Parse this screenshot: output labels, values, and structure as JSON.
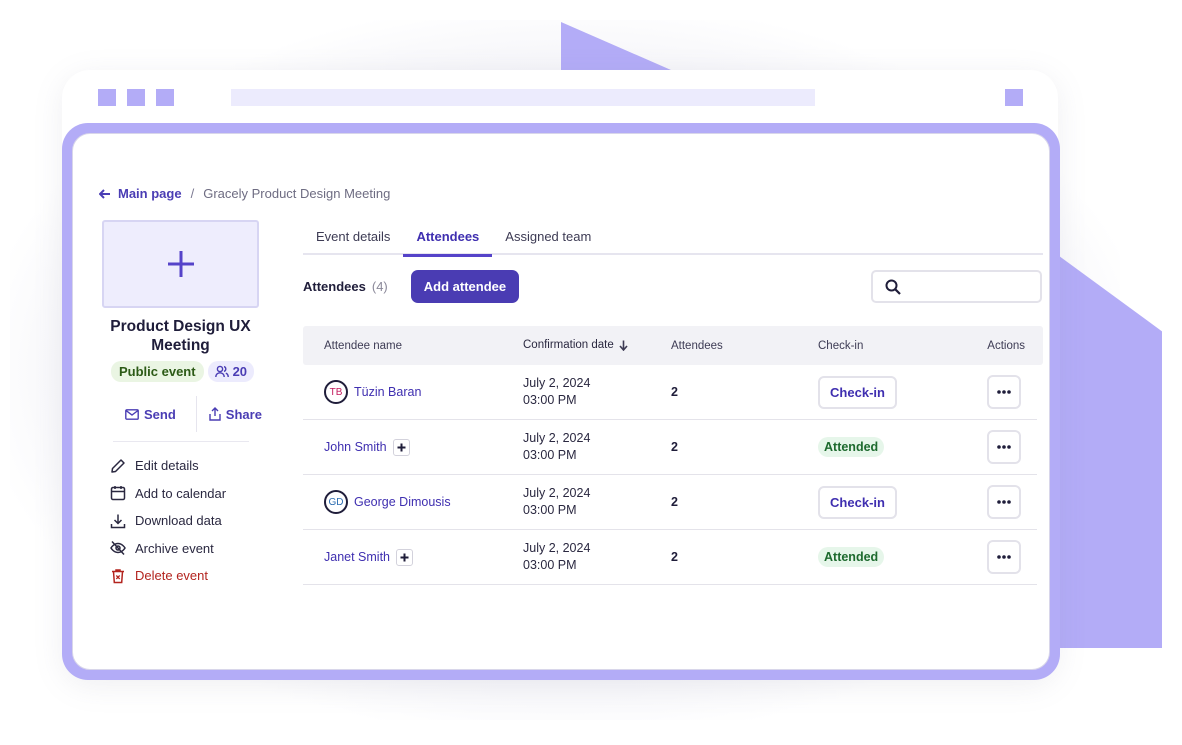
{
  "colors": {
    "accent": "#4a3cb3",
    "decor": "#b3acf7",
    "attended_bg": "#e6f6ea",
    "danger": "#b3241f"
  },
  "breadcrumb": {
    "back_label": "Main page",
    "separator": "/",
    "current": "Gracely Product Design Meeting"
  },
  "event": {
    "title": "Product Design UX Meeting",
    "visibility_tag": "Public event",
    "attendee_total": "20",
    "send_label": "Send",
    "share_label": "Share"
  },
  "menu": [
    {
      "label": "Edit details",
      "icon": "pencil-icon"
    },
    {
      "label": "Add to calendar",
      "icon": "calendar-icon"
    },
    {
      "label": "Download data",
      "icon": "download-icon"
    },
    {
      "label": "Archive event",
      "icon": "eye-off-icon"
    },
    {
      "label": "Delete event",
      "icon": "trash-icon"
    }
  ],
  "tabs": [
    {
      "label": "Event details",
      "active": false
    },
    {
      "label": "Attendees",
      "active": true
    },
    {
      "label": "Assigned team",
      "active": false
    }
  ],
  "attendees_section": {
    "label": "Attendees",
    "count": "(4)",
    "add_button": "Add attendee",
    "search_placeholder": ""
  },
  "table": {
    "columns": [
      "Attendee name",
      "Confirmation date",
      "Attendees",
      "Check-in",
      "Actions"
    ],
    "rows": [
      {
        "name": "Tüzin Baran",
        "initials": "TB",
        "initials_color": "#c2185b",
        "avatar": true,
        "date": "July 2, 2024",
        "time": "03:00 PM",
        "attendees": "2",
        "status": "button",
        "checkin_label": "Check-in"
      },
      {
        "name": "John Smith",
        "avatar": false,
        "date": "July 2, 2024",
        "time": "03:00 PM",
        "attendees": "2",
        "status": "badge",
        "checkin_label": "Attended"
      },
      {
        "name": "George Dimousis",
        "initials": "GD",
        "initials_color": "#2b6cb0",
        "avatar": true,
        "date": "July 2, 2024",
        "time": "03:00 PM",
        "attendees": "2",
        "status": "button",
        "checkin_label": "Check-in"
      },
      {
        "name": "Janet Smith",
        "avatar": false,
        "date": "July 2, 2024",
        "time": "03:00 PM",
        "attendees": "2",
        "status": "badge",
        "checkin_label": "Attended"
      }
    ]
  }
}
